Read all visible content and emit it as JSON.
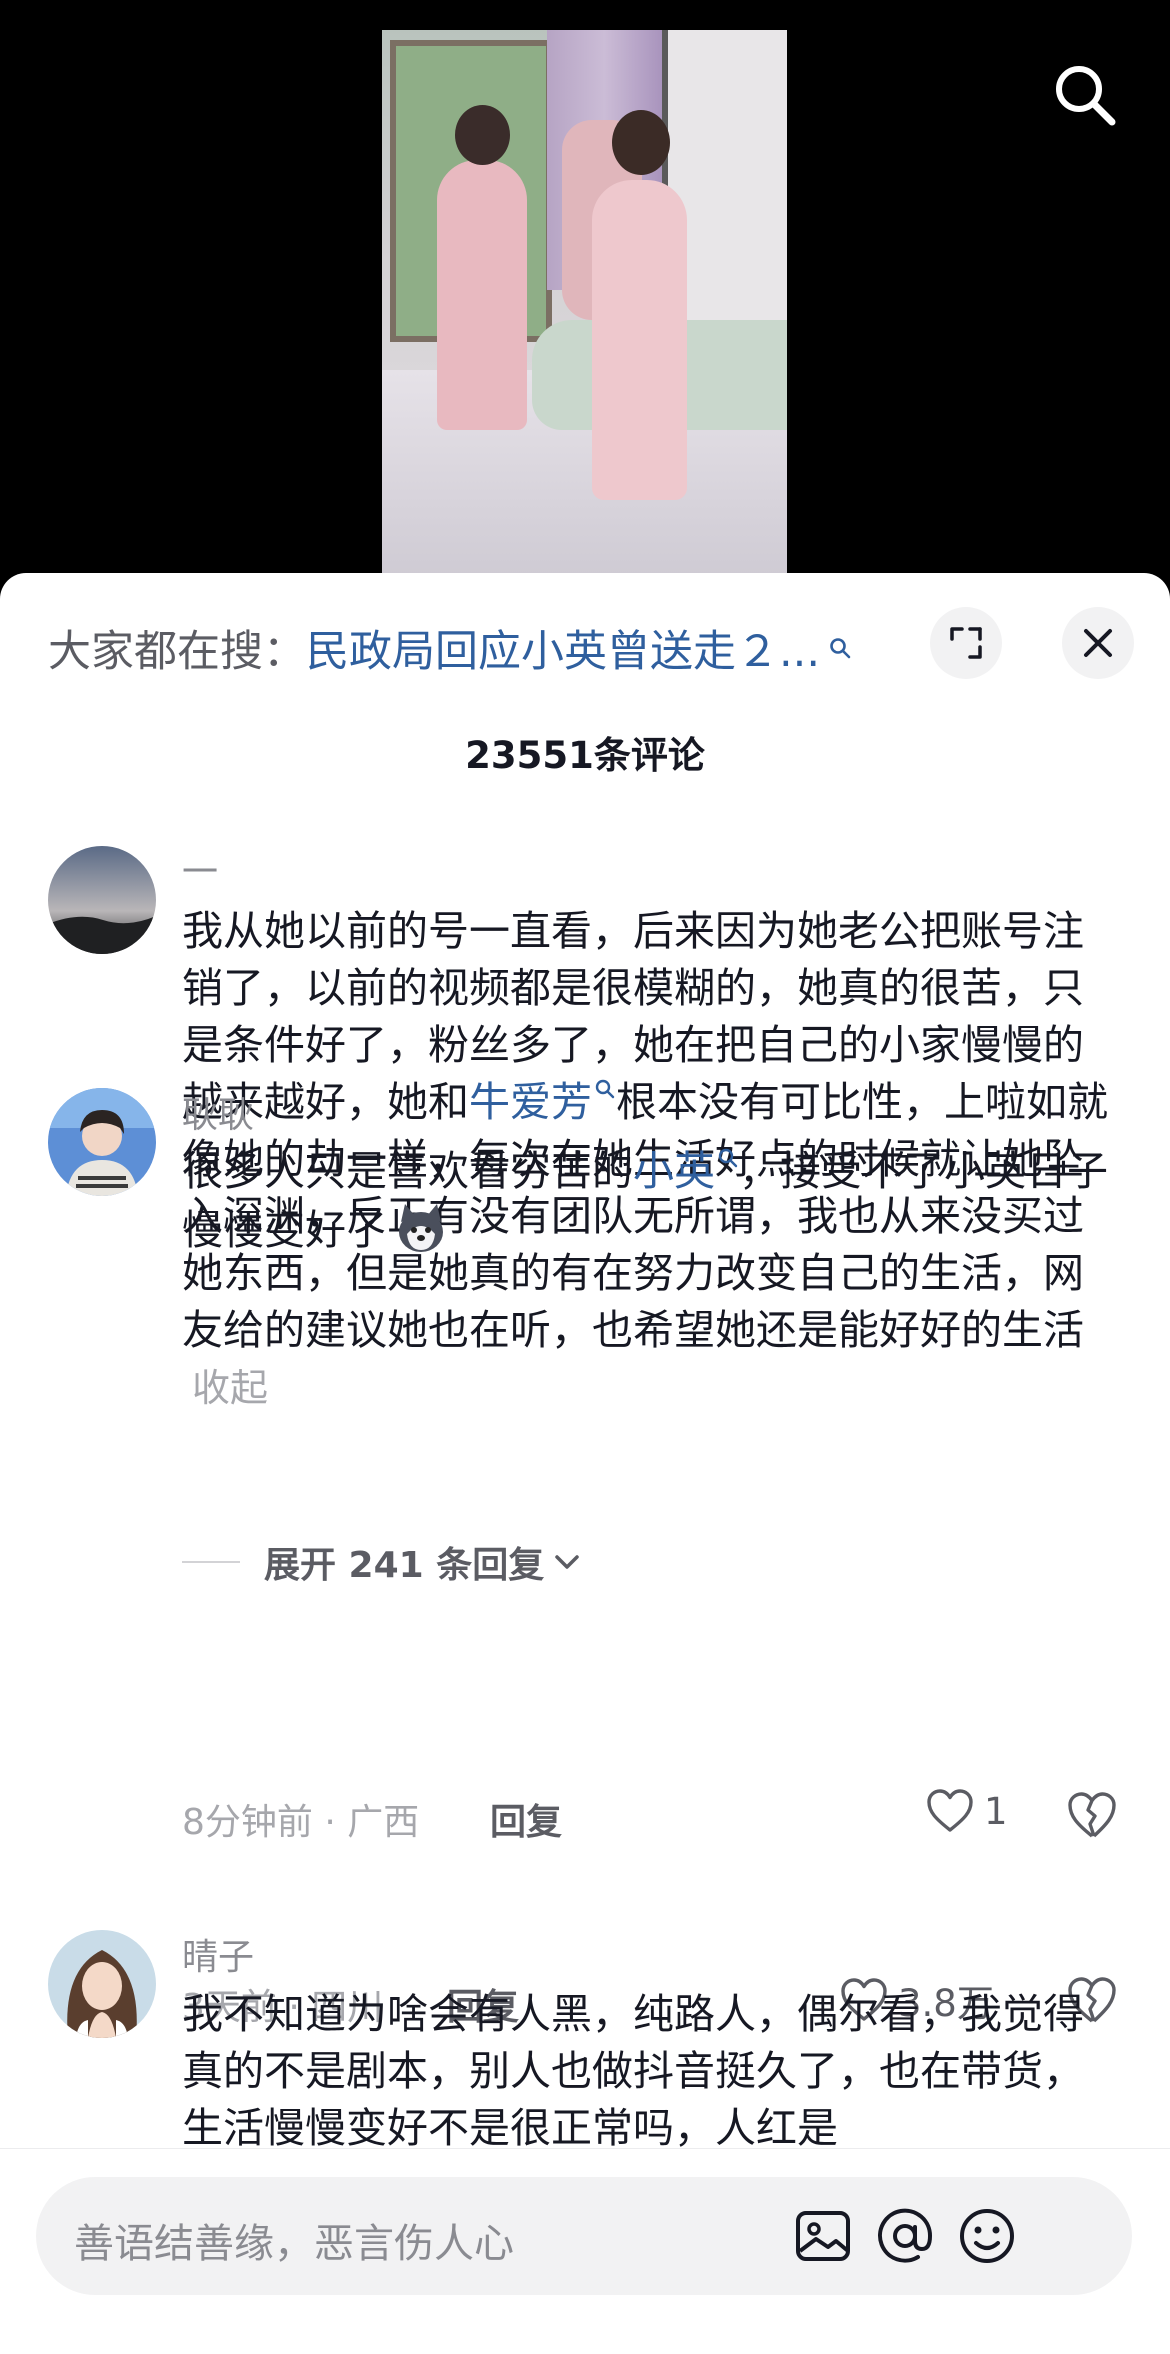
{
  "hot_search": {
    "prefix": "大家都在搜：",
    "link_text": "民政局回应小英曾送走２..."
  },
  "comment_count": "23551条评论",
  "comments": [
    {
      "username": "一",
      "text_before": "我从她以前的号一直看，后来因为她老公把账号注销了，以前的视频都是很模糊的，她真的很苦，只是条件好了，粉丝多了，她在把自己的小家慢慢的越来越好，她和",
      "highlight": "牛爱芳",
      "text_after": "根本没有可比性，上啦如就像她的劫一样，每次在她生活好点的时候就让她坠入深渊，反正有没有团队无所谓，我也从来没买过她东西，但是她真的有在努力改变自己的生活，网友给的建议她也在听，也希望她还是能好好的生活",
      "collapse_label": "收起",
      "meta": "3天前 · 四川",
      "reply_label": "回复",
      "likes": "3.8万"
    },
    {
      "username": "耿耿",
      "text_before": "很多人只是喜欢看穷苦的",
      "highlight": "小英",
      "text_after": "，接受不了小英日子慢慢变好了",
      "meta": "8分钟前 · 广西",
      "reply_label": "回复",
      "likes": "1"
    },
    {
      "username": "晴子",
      "text": "我不知道为啥会有人黑，纯路人，偶尔看，我觉得真的不是剧本，别人也做抖音挺久了，也在带货，生活慢慢变好不是很正常吗，人红是"
    }
  ],
  "expand_replies_label": "展开 241 条回复",
  "input": {
    "placeholder": "善语结善缘，恶言伤人心"
  },
  "icons": {
    "search": "search-icon",
    "expand": "expand-icon",
    "close": "close-icon",
    "heart": "heart-icon",
    "dislike": "broken-heart-icon",
    "image": "image-icon",
    "at": "at-icon",
    "emoji": "emoji-icon"
  },
  "colors": {
    "link": "#2f5f9e",
    "text": "#161823",
    "secondary": "#a6a7ac"
  }
}
